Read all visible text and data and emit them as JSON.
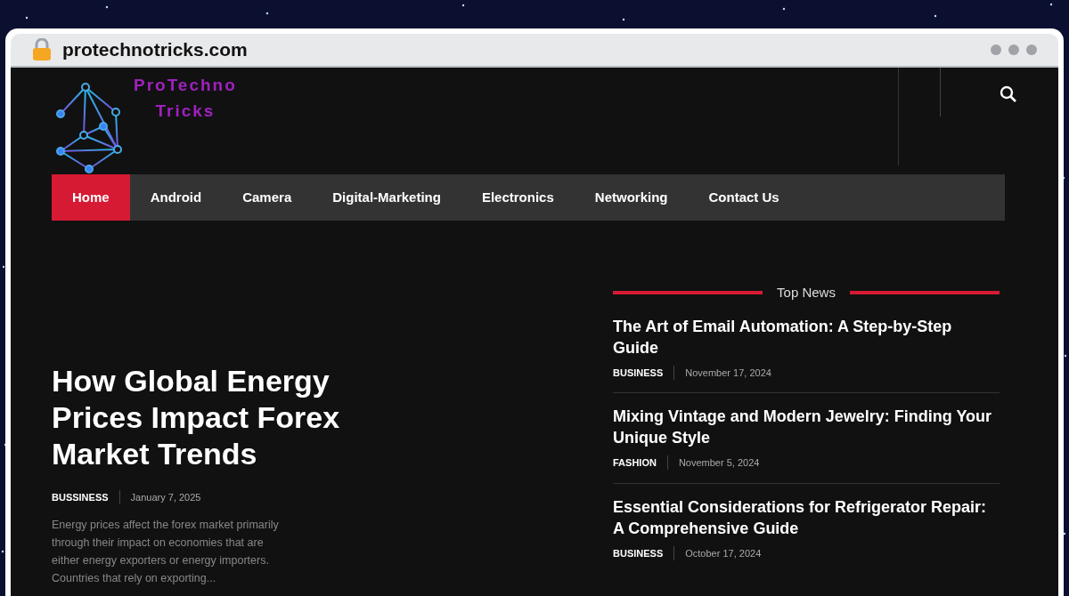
{
  "browser": {
    "url": "protechnotricks.com"
  },
  "logo": {
    "line_1": "ProTechno",
    "line_2": "Tricks"
  },
  "nav": [
    {
      "label": "Home",
      "selected": true
    },
    {
      "label": "Android",
      "selected": false
    },
    {
      "label": "Camera",
      "selected": false
    },
    {
      "label": "Digital-Marketing",
      "selected": false
    },
    {
      "label": "Electronics",
      "selected": false
    },
    {
      "label": "Networking",
      "selected": false
    },
    {
      "label": "Contact Us",
      "selected": false
    }
  ],
  "featured": {
    "title": "How Global Energy Prices Impact Forex Market Trends",
    "category": "BUSSINESS",
    "date": "January 7, 2025",
    "excerpt": "Energy prices affect the forex market primarily through their impact on economies that are either energy exporters or energy importers. Countries that rely on exporting..."
  },
  "top_news": {
    "heading": "Top News",
    "items": [
      {
        "title": "The Art of Email Automation: A Step-by-Step Guide",
        "category": "BUSINESS",
        "date": "November 17, 2024"
      },
      {
        "title": "Mixing Vintage and Modern Jewelry: Finding Your Unique Style",
        "category": "FASHION",
        "date": "November 5, 2024"
      },
      {
        "title": "Essential Considerations for Refrigerator Repair: A Comprehensive Guide",
        "category": "BUSINESS",
        "date": "October 17, 2024"
      }
    ]
  }
}
